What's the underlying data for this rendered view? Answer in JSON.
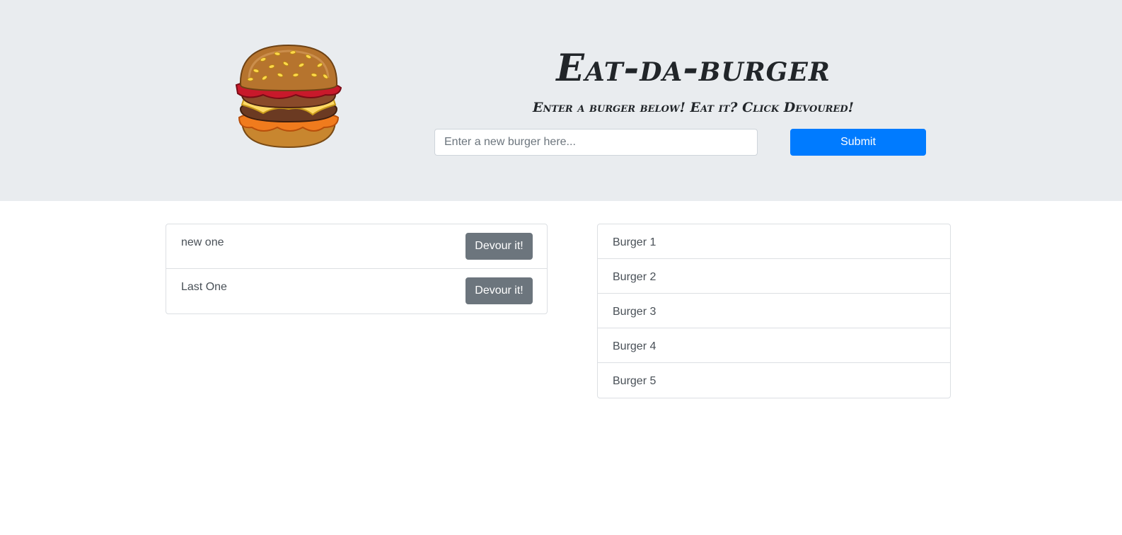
{
  "header": {
    "title": "Eat-da-burger",
    "subtitle": "Enter a burger below! Eat it? Click Devoured!",
    "logo_icon": "burger-icon"
  },
  "form": {
    "placeholder": "Enter a new burger here...",
    "value": "",
    "submit_label": "Submit"
  },
  "undevoured": [
    {
      "name": "new one",
      "button_label": "Devour it!"
    },
    {
      "name": "Last One",
      "button_label": "Devour it!"
    }
  ],
  "devoured": [
    {
      "name": "Burger 1"
    },
    {
      "name": "Burger 2"
    },
    {
      "name": "Burger 3"
    },
    {
      "name": "Burger 4"
    },
    {
      "name": "Burger 5"
    }
  ],
  "colors": {
    "jumbotron_bg": "#e9ecef",
    "primary": "#007bff",
    "secondary": "#6c757d"
  }
}
